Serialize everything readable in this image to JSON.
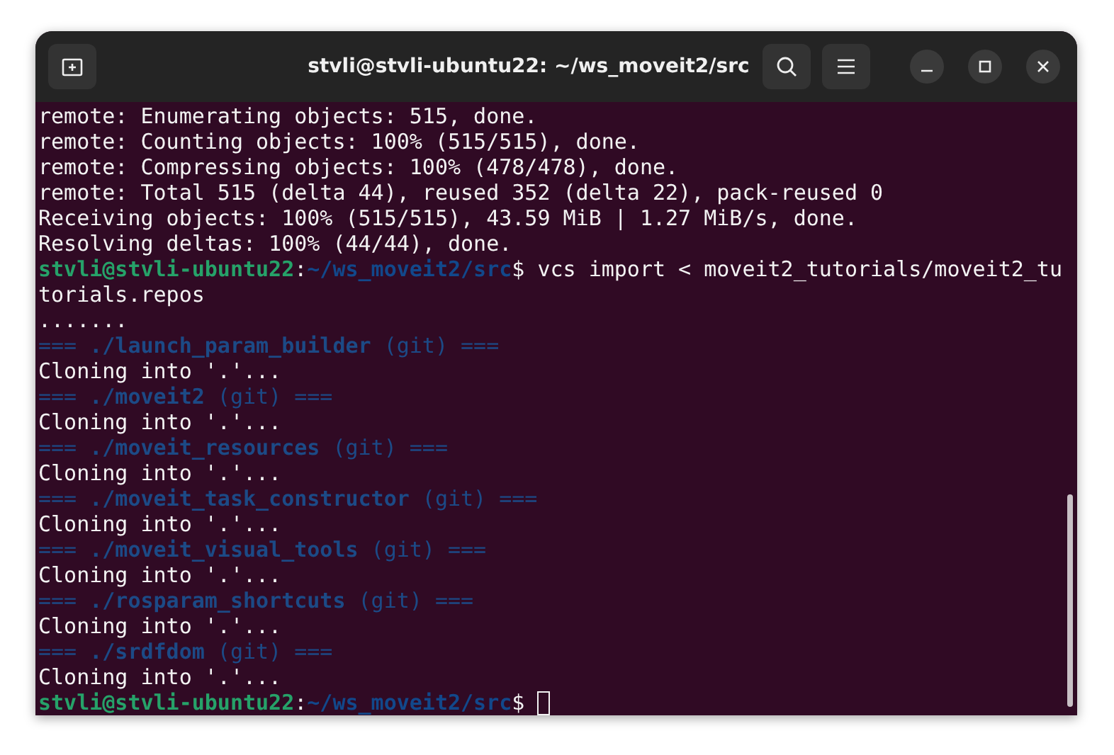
{
  "window": {
    "title": "stvli@stvli-ubuntu22: ~/ws_moveit2/src"
  },
  "lines": [
    [
      {
        "kind": "text",
        "text": "remote: Enumerating objects: 515, done."
      }
    ],
    [
      {
        "kind": "text",
        "text": "remote: Counting objects: 100% (515/515), done."
      }
    ],
    [
      {
        "kind": "text",
        "text": "remote: Compressing objects: 100% (478/478), done."
      }
    ],
    [
      {
        "kind": "text",
        "text": "remote: Total 515 (delta 44), reused 352 (delta 22), pack-reused 0"
      }
    ],
    [
      {
        "kind": "text",
        "text": "Receiving objects: 100% (515/515), 43.59 MiB | 1.27 MiB/s, done."
      }
    ],
    [
      {
        "kind": "text",
        "text": "Resolving deltas: 100% (44/44), done."
      }
    ],
    [
      {
        "kind": "user",
        "text": "stvli@stvli-ubuntu22"
      },
      {
        "kind": "text",
        "text": ":"
      },
      {
        "kind": "path",
        "text": "~/ws_moveit2/src"
      },
      {
        "kind": "text",
        "text": "$ vcs import < moveit2_tutorials/moveit2_tu"
      }
    ],
    [
      {
        "kind": "text",
        "text": "torials.repos"
      }
    ],
    [
      {
        "kind": "text",
        "text": "......."
      }
    ],
    [
      {
        "kind": "repo",
        "text": "=== "
      },
      {
        "kind": "repo_name",
        "text": "./launch_param_builder"
      },
      {
        "kind": "repo",
        "text": " (git) ==="
      }
    ],
    [
      {
        "kind": "text",
        "text": "Cloning into '.'..."
      }
    ],
    [
      {
        "kind": "repo",
        "text": "=== "
      },
      {
        "kind": "repo_name",
        "text": "./moveit2"
      },
      {
        "kind": "repo",
        "text": " (git) ==="
      }
    ],
    [
      {
        "kind": "text",
        "text": "Cloning into '.'..."
      }
    ],
    [
      {
        "kind": "repo",
        "text": "=== "
      },
      {
        "kind": "repo_name",
        "text": "./moveit_resources"
      },
      {
        "kind": "repo",
        "text": " (git) ==="
      }
    ],
    [
      {
        "kind": "text",
        "text": "Cloning into '.'..."
      }
    ],
    [
      {
        "kind": "repo",
        "text": "=== "
      },
      {
        "kind": "repo_name",
        "text": "./moveit_task_constructor"
      },
      {
        "kind": "repo",
        "text": " (git) ==="
      }
    ],
    [
      {
        "kind": "text",
        "text": "Cloning into '.'..."
      }
    ],
    [
      {
        "kind": "repo",
        "text": "=== "
      },
      {
        "kind": "repo_name",
        "text": "./moveit_visual_tools"
      },
      {
        "kind": "repo",
        "text": " (git) ==="
      }
    ],
    [
      {
        "kind": "text",
        "text": "Cloning into '.'..."
      }
    ],
    [
      {
        "kind": "repo",
        "text": "=== "
      },
      {
        "kind": "repo_name",
        "text": "./rosparam_shortcuts"
      },
      {
        "kind": "repo",
        "text": " (git) ==="
      }
    ],
    [
      {
        "kind": "text",
        "text": "Cloning into '.'..."
      }
    ],
    [
      {
        "kind": "repo",
        "text": "=== "
      },
      {
        "kind": "repo_name",
        "text": "./srdfdom"
      },
      {
        "kind": "repo",
        "text": " (git) ==="
      }
    ],
    [
      {
        "kind": "text",
        "text": "Cloning into '.'..."
      }
    ],
    [
      {
        "kind": "user",
        "text": "stvli@stvli-ubuntu22"
      },
      {
        "kind": "text",
        "text": ":"
      },
      {
        "kind": "path",
        "text": "~/ws_moveit2/src"
      },
      {
        "kind": "text",
        "text": "$ "
      },
      {
        "kind": "cursor"
      }
    ]
  ]
}
